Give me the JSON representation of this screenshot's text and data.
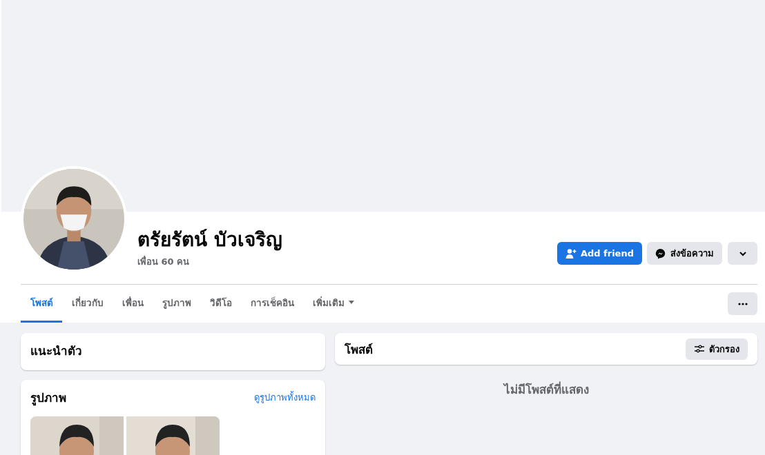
{
  "profile": {
    "name": "ตรัยรัตน์ บัวเจริญ",
    "friends": "เพื่อน 60 คน"
  },
  "actions": [
    {
      "kind": "primary",
      "label": "Add friend"
    },
    {
      "kind": "message",
      "label": "ส่งข้อความ"
    },
    {
      "kind": "dropdown"
    }
  ],
  "tabs": [
    {
      "label": "โพสต์",
      "selected": true,
      "kind": "tab"
    },
    {
      "label": "เกี่ยวกับ",
      "selected": false,
      "kind": "tab"
    },
    {
      "label": "เพื่อน",
      "selected": false,
      "kind": "tab"
    },
    {
      "label": "รูปภาพ",
      "selected": false,
      "kind": "tab"
    },
    {
      "label": "วิดีโอ",
      "selected": false,
      "kind": "tab"
    },
    {
      "label": "การเช็คอิน",
      "selected": false,
      "kind": "tab"
    },
    {
      "label": "เพิ่มเติม",
      "selected": false,
      "kind": "menu"
    }
  ],
  "intro": {
    "title": "แนะนำตัว"
  },
  "photos": {
    "title": "รูปภาพ",
    "link": "ดูรูปภาพทั้งหมด"
  },
  "posts": {
    "title": "โพสต์",
    "filter": "ตัวกรอง",
    "empty_message": "ไม่มีโพสต์ที่แสดง"
  }
}
